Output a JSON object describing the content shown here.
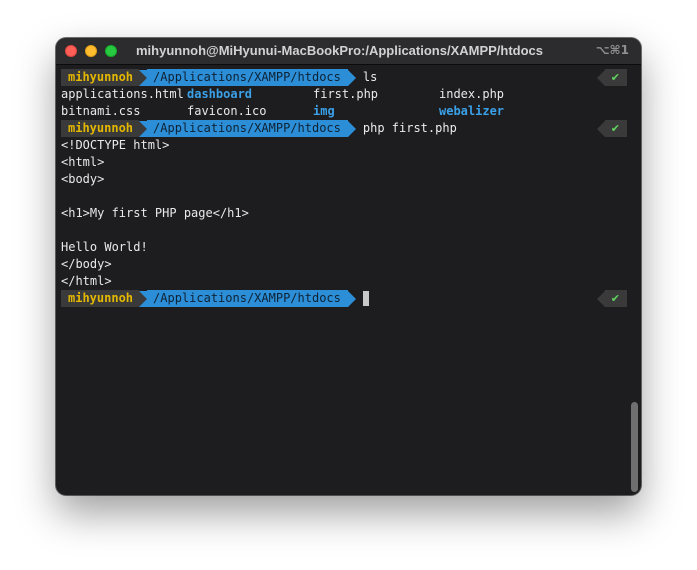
{
  "window": {
    "title": "mihyunnoh@MiHyunui-MacBookPro:/Applications/XAMPP/htdocs",
    "shortcut": "⌥⌘1"
  },
  "prompt": {
    "user": "mihyunnoh",
    "path": "/Applications/XAMPP/htdocs",
    "status_icon": "✔"
  },
  "session": {
    "command1": "ls",
    "ls_row1": [
      {
        "text": "applications.html",
        "dir": false
      },
      {
        "text": "dashboard",
        "dir": true
      },
      {
        "text": "first.php",
        "dir": false
      },
      {
        "text": "index.php",
        "dir": false
      }
    ],
    "ls_row2": [
      {
        "text": "bitnami.css",
        "dir": false
      },
      {
        "text": "favicon.ico",
        "dir": false
      },
      {
        "text": "img",
        "dir": true
      },
      {
        "text": "webalizer",
        "dir": true
      }
    ],
    "command2": "php first.php",
    "output": [
      "<!DOCTYPE html>",
      "<html>",
      "<body>",
      "",
      "<h1>My first PHP page</h1>",
      "",
      "Hello World!",
      "</body>",
      "</html>"
    ]
  },
  "colors": {
    "terminal_bg": "#1d1d1f",
    "user_segment_fg": "#e5b800",
    "path_segment_bg": "#2d8ed8",
    "directory_fg": "#3aa0e8",
    "status_check": "#5fd45f"
  }
}
